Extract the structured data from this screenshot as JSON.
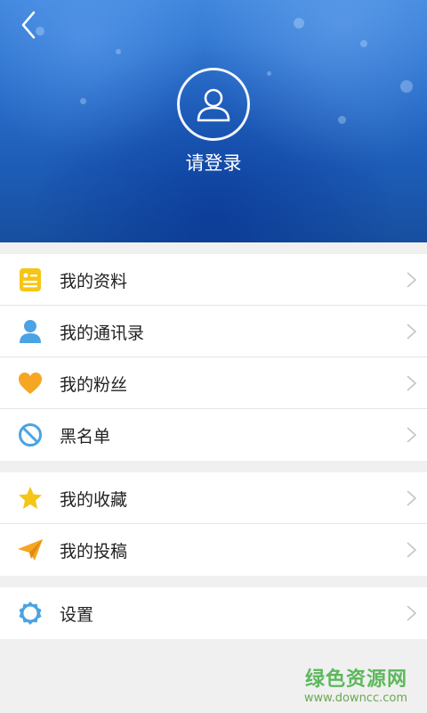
{
  "header": {
    "login_label": "请登录"
  },
  "menu": {
    "group1": [
      {
        "label": "我的资料",
        "icon": "profile-card-icon"
      },
      {
        "label": "我的通讯录",
        "icon": "contacts-person-icon"
      },
      {
        "label": "我的粉丝",
        "icon": "heart-icon"
      },
      {
        "label": "黑名单",
        "icon": "block-icon"
      }
    ],
    "group2": [
      {
        "label": "我的收藏",
        "icon": "star-icon"
      },
      {
        "label": "我的投稿",
        "icon": "paper-plane-icon"
      }
    ],
    "group3": [
      {
        "label": "设置",
        "icon": "gear-icon"
      }
    ]
  },
  "watermark": {
    "title": "绿色资源网",
    "url": "www.downcc.com"
  },
  "colors": {
    "header_blue": "#2a6fcb",
    "icon_yellow": "#f5c518",
    "icon_blue": "#4ba3e3",
    "icon_orange": "#f5a623"
  }
}
